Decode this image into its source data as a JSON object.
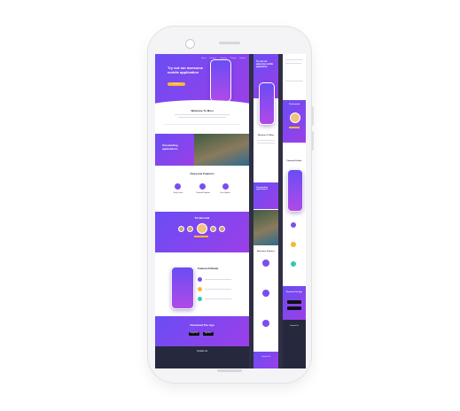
{
  "page1": {
    "nav": [
      "Home",
      "Features",
      "Reviews",
      "Pricing",
      "Contact"
    ],
    "hero_title": "Try out our awesome mobile application",
    "hero_cta": "Get Started",
    "welcome_title": "Welcome To Mosi",
    "testing_title": "Outstanding applications",
    "features_title": "Awesome Features",
    "feature_items": [
      "Easy to use",
      "Powerful Support",
      "Free Update"
    ],
    "testimonial_title": "Testimonial",
    "featured_title": "Featured Details",
    "download_title": "Download The App",
    "store_google": "Google Play",
    "store_apple": "App Store",
    "footer_title": "Contact Us"
  },
  "page2": {
    "hero_title": "Try out our awesome mobile application",
    "welcome_title": "Welcome To Mosi",
    "testing_title": "Outstanding applications",
    "features_title": "Awesome Features",
    "footer_title": "Contact Us"
  },
  "page3": {
    "testimonial_title": "Testimonial",
    "featured_title": "Featured Details",
    "download_title": "Download The App",
    "footer_title": "Contact Us"
  },
  "colors": {
    "primary": "#6a4df4",
    "secondary": "#9b3fe8",
    "accent": "#f7b731",
    "teal": "#35c9b1",
    "dark": "#26283d"
  }
}
